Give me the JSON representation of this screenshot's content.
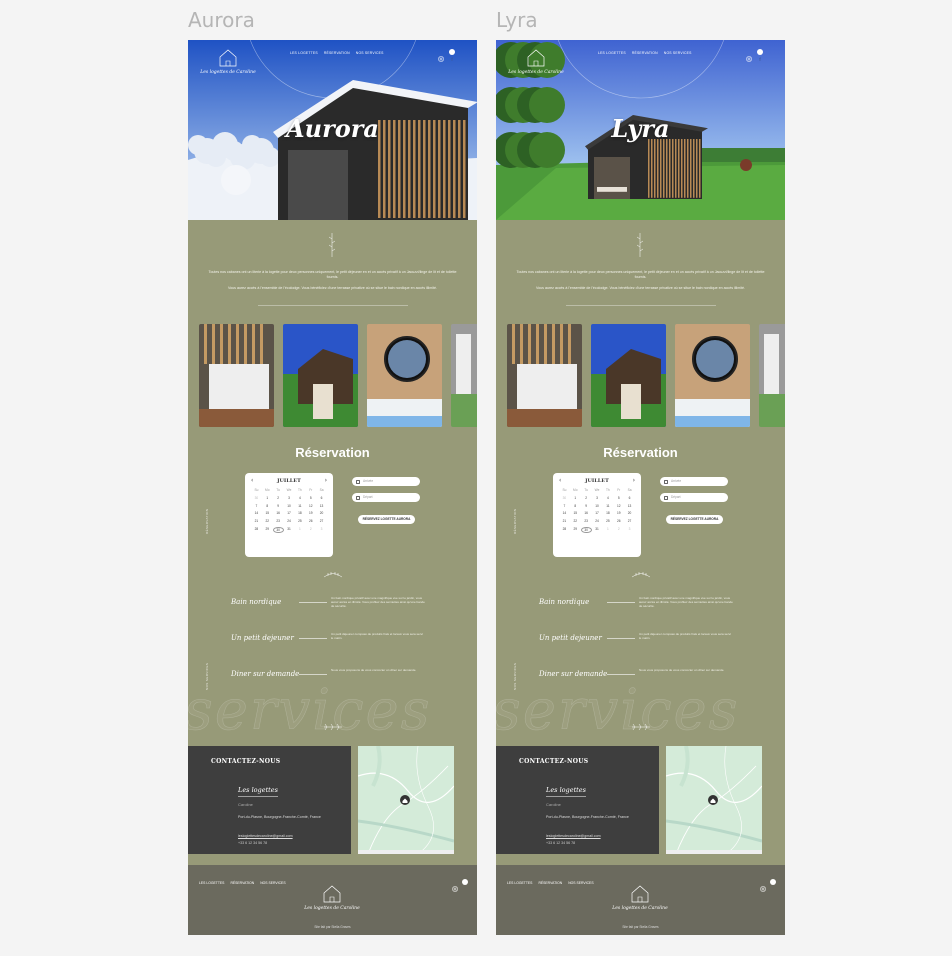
{
  "frames": [
    {
      "label": "Aurora",
      "hero_title": "Aurora",
      "variant": "winter",
      "button": "RÉSERVEZ LOGETTE AURORA"
    },
    {
      "label": "Lyra",
      "hero_title": "Lyra",
      "variant": "summer",
      "button": "RÉSERVEZ LOGETTE AURORA"
    }
  ],
  "nav": {
    "links": [
      "LES LOGETTES",
      "RÉSERVATION",
      "NOS SERVICES"
    ],
    "social": [
      "instagram-icon",
      "facebook-icon"
    ]
  },
  "logo_text": "Les logettes de Caroline",
  "intro": {
    "p1": "Toutes nos cabanes ont un literie à la logette pour deux personnes uniquement, le petit déjeuner en et un accès privatif à un Jacuzzi/linge de lit et de toilette fournis.",
    "p2": "Vous aurez accès à l'ensemble de l'écolodge. Vous bénéficiez d'une terrasse privative où se situe le bain nordique en accès illimité."
  },
  "reservation": {
    "title": "Réservation",
    "side_label": "RÉSERVATION",
    "month": "JUILLET",
    "day_headers": [
      "Su",
      "Mo",
      "Tu",
      "We",
      "Th",
      "Fr",
      "Sa"
    ],
    "weeks": [
      [
        "30",
        "1",
        "2",
        "3",
        "4",
        "5",
        "6"
      ],
      [
        "7",
        "8",
        "9",
        "10",
        "11",
        "12",
        "13"
      ],
      [
        "14",
        "15",
        "16",
        "17",
        "18",
        "19",
        "20"
      ],
      [
        "21",
        "22",
        "23",
        "24",
        "25",
        "26",
        "27"
      ],
      [
        "28",
        "29",
        "30",
        "31",
        "1",
        "2",
        "3"
      ]
    ],
    "arrival_placeholder": "Arrivée",
    "departure_placeholder": "Départ"
  },
  "services": {
    "side_label": "NOS SERVICES",
    "watermark": "services",
    "items": [
      {
        "name": "Bain nordique",
        "desc": "Un bain nordique privatif avec une magnifique vue sur le jardin, vous aurez accès en illimité. Vous profitez des serviettes ainsi qu'une bande de sécurité."
      },
      {
        "name": "Un petit dejeuner",
        "desc": "Un petit déjeuner composé de produits frais et locaux vous sera servi le matin."
      },
      {
        "name": "Diner sur demande",
        "desc": "Nous vous proposons de vous concocter un dîner sur demande."
      }
    ]
  },
  "contact": {
    "heading": "CONTACTEZ-NOUS",
    "name": "Les logettes",
    "person": "Caroline",
    "address": "Port-du-Plasne, Bourgogne-Franche-Comté, France",
    "email": "lesloglettesdecaroline@gmail.com",
    "phone": "+33 6 12 34 56 78"
  },
  "footer": {
    "links": [
      "LES LOGETTES",
      "RÉSERVATION",
      "NOS SERVICES"
    ],
    "copyright": "Site fait par Stella Graves"
  },
  "colors": {
    "background": "#979a78",
    "contact_bg": "#3e3e3e",
    "footer_bg": "#6b6a5e",
    "page": "#f4f4f4"
  }
}
